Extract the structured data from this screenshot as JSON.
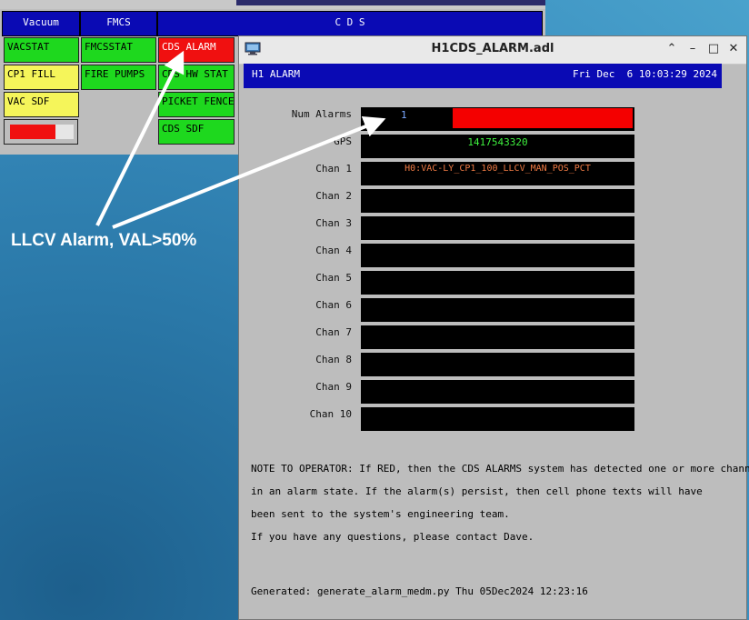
{
  "background_window": {
    "headers": {
      "vacuum": "Vacuum",
      "fmcs": "FMCS",
      "cds": "C D S"
    },
    "vacuum_items": [
      {
        "label": "VACSTAT",
        "status": "green"
      },
      {
        "label": "CP1 FILL",
        "status": "yellow"
      },
      {
        "label": "VAC SDF",
        "status": "yellow"
      }
    ],
    "fmcs_items": [
      {
        "label": "FMCSSTAT",
        "status": "green"
      },
      {
        "label": "FIRE PUMPS",
        "status": "green"
      }
    ],
    "cds_items": [
      {
        "label": "CDS ALARM",
        "status": "red"
      },
      {
        "label": "CDS HW STAT",
        "status": "green"
      },
      {
        "label": "PICKET FENCE",
        "status": "green"
      },
      {
        "label": "CDS SDF",
        "status": "green"
      }
    ]
  },
  "annotation": {
    "label": "LLCV Alarm, VAL>50%"
  },
  "window": {
    "title": "H1CDS_ALARM.adl",
    "buttons": {
      "maximize": "⌃",
      "minimize": "–",
      "restore": "□",
      "close": "✕"
    }
  },
  "header": {
    "left": "H1 ALARM",
    "right": "Fri Dec  6 10:03:29 2024"
  },
  "num_alarms": {
    "label": "Num Alarms",
    "value": "1"
  },
  "gps": {
    "label": "GPS",
    "value": "1417543320"
  },
  "channels": [
    {
      "label": "Chan 1",
      "value": "H0:VAC-LY_CP1_100_LLCV_MAN_POS_PCT"
    },
    {
      "label": "Chan 2",
      "value": ""
    },
    {
      "label": "Chan 3",
      "value": ""
    },
    {
      "label": "Chan 4",
      "value": ""
    },
    {
      "label": "Chan 5",
      "value": ""
    },
    {
      "label": "Chan 6",
      "value": ""
    },
    {
      "label": "Chan 7",
      "value": ""
    },
    {
      "label": "Chan 8",
      "value": ""
    },
    {
      "label": "Chan 9",
      "value": ""
    },
    {
      "label": "Chan 10",
      "value": ""
    }
  ],
  "note": [
    "NOTE TO OPERATOR: If RED, then the CDS ALARMS system has detected one or more channels",
    "in an alarm state. If the alarm(s) persist, then cell phone texts will have",
    "been sent to the system's engineering team.",
    "If you have any questions, please contact Dave."
  ],
  "generated": "Generated: generate_alarm_medm.py Thu 05Dec2024 12:23:16",
  "colors": {
    "alarm_red": "#f40000",
    "header_blue": "#0a0ab4",
    "ok_green": "#1ed81e",
    "warn_yellow": "#f5f55a"
  }
}
